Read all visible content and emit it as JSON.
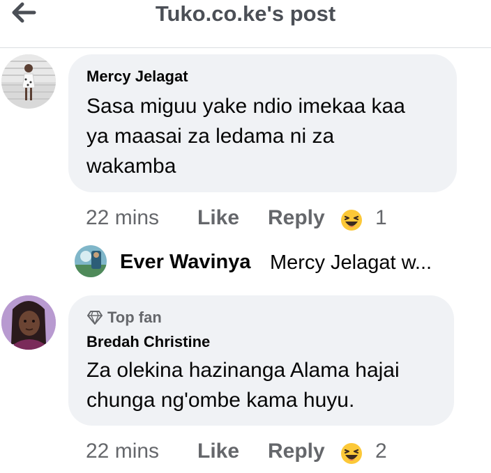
{
  "header": {
    "title": "Tuko.co.ke's post",
    "back_icon": "arrow-left-icon"
  },
  "comments": [
    {
      "author": "Mercy Jelagat",
      "text_lines": [
        "Sasa miguu yake ndio imekaa kaa",
        "ya maasai za ledama ni za",
        "wakamba"
      ],
      "time": "22 mins",
      "like_label": "Like",
      "reply_label": "Reply",
      "reaction_icon": "laughing-emoji-icon",
      "reaction_count": "1"
    },
    {
      "badge": "Top fan",
      "badge_icon": "diamond-icon",
      "author": "Bredah Christine",
      "text_lines": [
        "Za olekina hazinanga Alama hajai",
        "chunga ng'ombe kama huyu."
      ],
      "time": "22 mins",
      "like_label": "Like",
      "reply_label": "Reply",
      "reaction_icon": "laughing-emoji-icon",
      "reaction_count": "2"
    }
  ],
  "reply_preview": {
    "author": "Ever Wavinya",
    "snippet": "Mercy Jelagat w..."
  },
  "colors": {
    "bubble": "#f0f2f5",
    "secondary_text": "#65676b",
    "primary_text": "#050505",
    "emoji_yellow": "#fcc838"
  }
}
